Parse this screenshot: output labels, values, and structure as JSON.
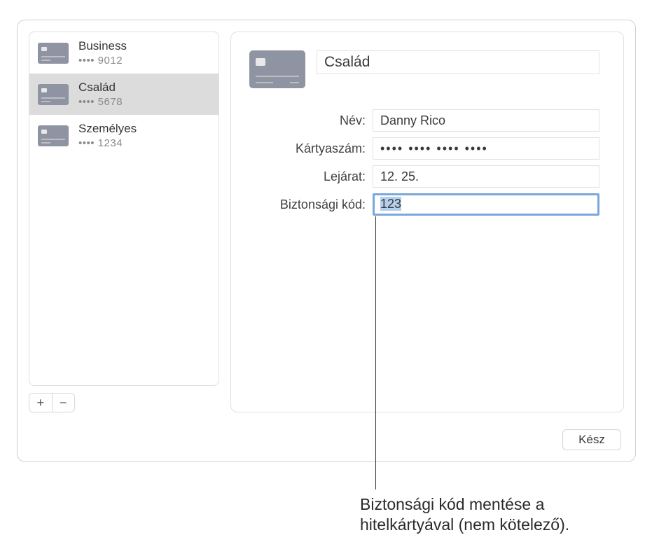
{
  "sidebar": {
    "items": [
      {
        "name": "Business",
        "number": "•••• 9012"
      },
      {
        "name": "Család",
        "number": "•••• 5678"
      },
      {
        "name": "Személyes",
        "number": "•••• 1234"
      }
    ],
    "add_label": "+",
    "remove_label": "−"
  },
  "detail": {
    "title_value": "Család",
    "fields": {
      "name": {
        "label": "Név:",
        "value": "Danny Rico"
      },
      "number": {
        "label": "Kártyaszám:",
        "value": "•••• •••• •••• ••••"
      },
      "expiry": {
        "label": "Lejárat:",
        "value": "12. 25."
      },
      "cvc": {
        "label": "Biztonsági kód:",
        "value": "123"
      }
    }
  },
  "buttons": {
    "done": "Kész"
  },
  "annotation": "Biztonsági kód mentése a hitelkártyával (nem kötelező)."
}
